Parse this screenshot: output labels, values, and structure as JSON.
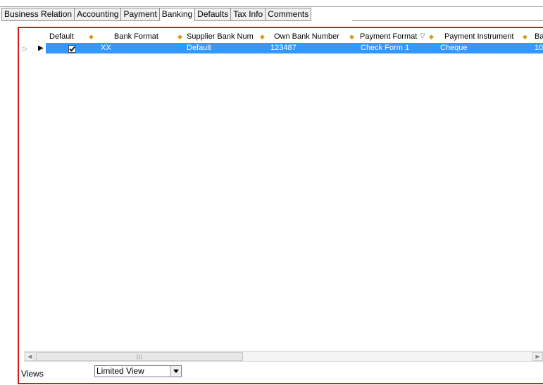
{
  "tabs": [
    {
      "label": "Business Relation"
    },
    {
      "label": "Accounting"
    },
    {
      "label": "Payment"
    },
    {
      "label": "Banking",
      "active": true
    },
    {
      "label": "Defaults"
    },
    {
      "label": "Tax Info"
    },
    {
      "label": "Comments"
    }
  ],
  "grid": {
    "columns": {
      "default": "Default",
      "bank_format": "Bank Format",
      "supplier_bank_num": "Supplier Bank Num",
      "own_bank_number": "Own Bank Number",
      "payment_format": "Payment Format",
      "payment_instrument": "Payment Instrument",
      "next": "Ba"
    },
    "row": {
      "default_checked": true,
      "bank_format": "XX",
      "supplier_bank_num": "Default",
      "own_bank_number": "123487",
      "payment_format": "Check Form 1",
      "payment_instrument": "Cheque",
      "next": "10"
    },
    "selection_color": "#3399ff",
    "accent_border": "#d31c1c",
    "header_icon_color": "#d49a1a"
  },
  "views": {
    "label": "Views",
    "selected": "Limited View"
  },
  "icons": {
    "header_marker": "diamond-marker-icon",
    "sort": "sort-descending-icon",
    "row_current": "current-row-arrow-icon",
    "row_expand": "expand-row-icon"
  }
}
